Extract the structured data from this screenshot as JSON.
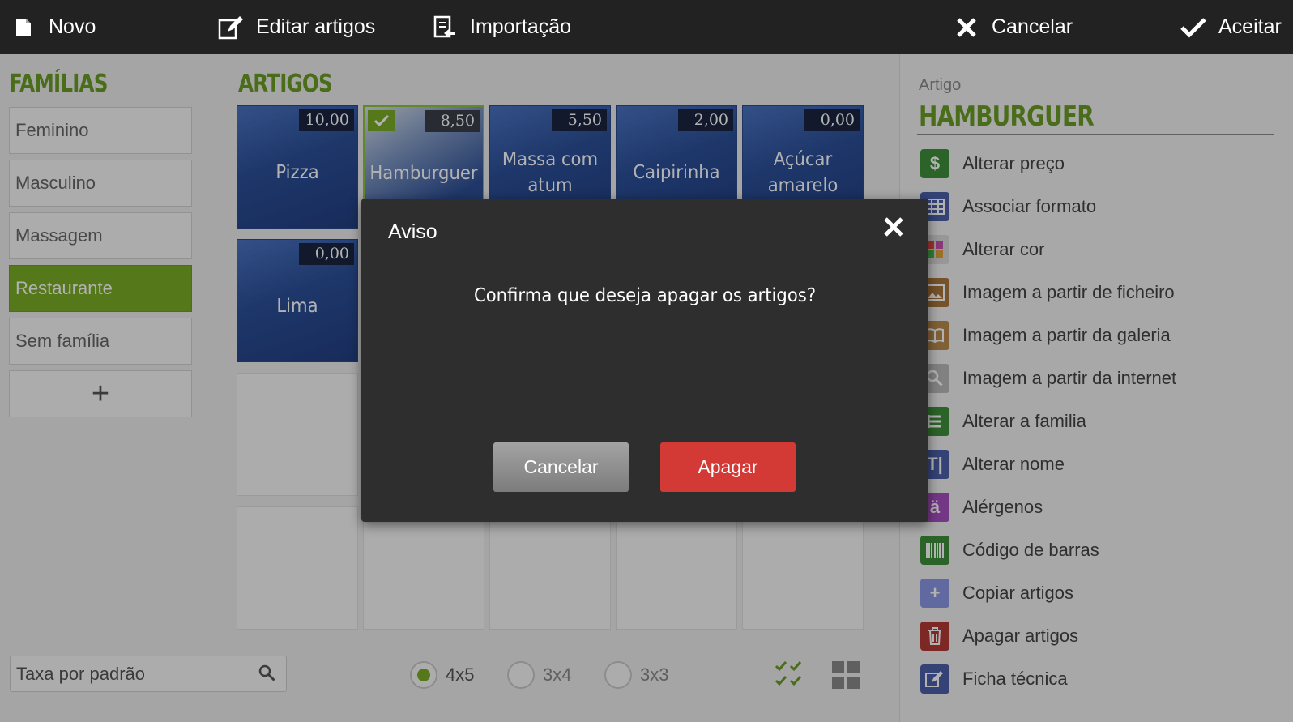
{
  "toolbar": {
    "novo": "Novo",
    "editar": "Editar artigos",
    "importacao": "Importação",
    "cancelar": "Cancelar",
    "aceitar": "Aceitar"
  },
  "families": {
    "title": "FAMÍLIAS",
    "items": [
      "Feminino",
      "Masculino",
      "Massagem",
      "Restaurante",
      "Sem família"
    ],
    "active": "Restaurante",
    "add": "+"
  },
  "articles": {
    "title": "ARTIGOS",
    "items": [
      {
        "name": "Pizza",
        "price": "10,00"
      },
      {
        "name": "Hamburguer",
        "price": "8,50",
        "selected": true
      },
      {
        "name": "Massa com atum",
        "price": "5,50"
      },
      {
        "name": "Caipirinha",
        "price": "2,00"
      },
      {
        "name": "Açúcar amarelo",
        "price": "0,00"
      },
      {
        "name": "Lima",
        "price": "0,00"
      }
    ]
  },
  "bottom": {
    "tax_placeholder": "Taxa por padrão",
    "layouts": [
      "4x5",
      "3x4",
      "3x3"
    ],
    "selected_layout": "4x5"
  },
  "panel": {
    "label": "Artigo",
    "name": "HAMBURGUER",
    "actions": [
      {
        "label": "Alterar preço",
        "icon": "dollar-icon",
        "color": "#3f8f3a"
      },
      {
        "label": "Associar formato",
        "icon": "table-icon",
        "color": "#4b5fa8"
      },
      {
        "label": "Alterar cor",
        "icon": "palette-icon",
        "color": "#d8d8d8"
      },
      {
        "label": "Imagem a partir de ficheiro",
        "icon": "image-icon",
        "color": "#a8763c"
      },
      {
        "label": "Imagem a partir da galeria",
        "icon": "book-icon",
        "color": "#b98a4c"
      },
      {
        "label": "Imagem a partir da internet",
        "icon": "magnifier-icon",
        "color": "#b9b9b9"
      },
      {
        "label": "Alterar a familia",
        "icon": "family-icon",
        "color": "#3f8f3a"
      },
      {
        "label": "Alterar nome",
        "icon": "text-icon",
        "color": "#4b5fa8"
      },
      {
        "label": "Alérgenos",
        "icon": "allergen-icon",
        "color": "#a64fc0"
      },
      {
        "label": "Código de barras",
        "icon": "barcode-icon",
        "color": "#3f8f3a"
      },
      {
        "label": "Copiar artigos",
        "icon": "plus-icon",
        "color": "#8c98e6"
      },
      {
        "label": "Apagar artigos",
        "icon": "trash-icon",
        "color": "#b33a34"
      },
      {
        "label": "Ficha técnica",
        "icon": "edit-icon",
        "color": "#4b5fa8"
      }
    ]
  },
  "modal": {
    "title": "Aviso",
    "message": "Confirma que deseja apagar os artigos?",
    "cancel": "Cancelar",
    "confirm": "Apagar"
  }
}
